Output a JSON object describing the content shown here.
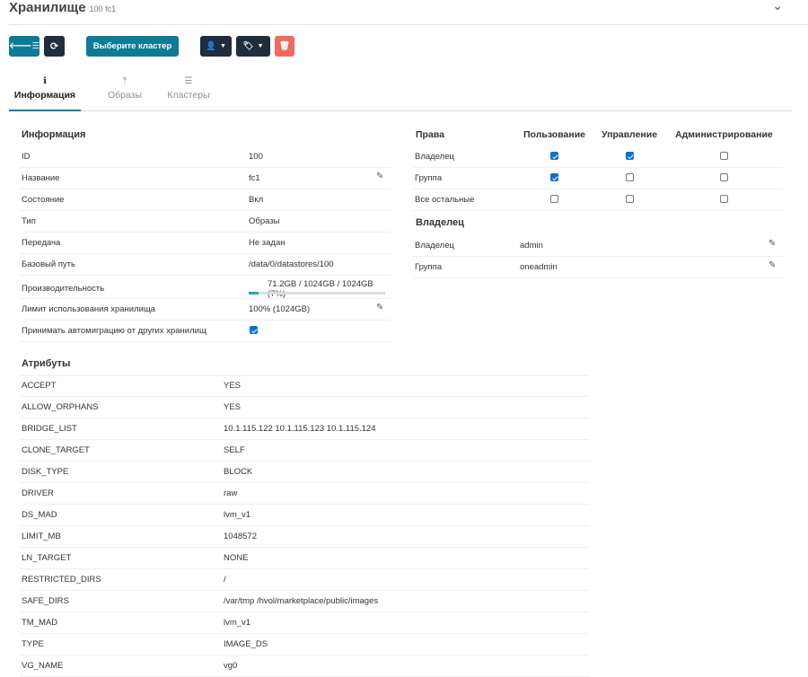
{
  "header": {
    "title": "Хранилище",
    "subtitle": "100 fc1"
  },
  "toolbar": {
    "select_cluster_label": "Выберите кластер",
    "icons": [
      "back-list-icon",
      "refresh-icon",
      "user-icon",
      "tag-icon",
      "trash-icon"
    ]
  },
  "tabs": [
    {
      "label": "Информация",
      "icon": "info-icon",
      "active": true
    },
    {
      "label": "Образы",
      "icon": "upload-icon",
      "active": false
    },
    {
      "label": "Кластеры",
      "icon": "list-icon",
      "active": false
    }
  ],
  "info": {
    "title": "Информация",
    "rows": [
      {
        "key": "ID",
        "value": "100"
      },
      {
        "key": "Название",
        "value": "fc1"
      },
      {
        "key": "Состояние",
        "value": "Вкл"
      },
      {
        "key": "Тип",
        "value": "Образы"
      },
      {
        "key": "Передача",
        "value": "Не задан"
      },
      {
        "key": "Базовый путь",
        "value": "/data/0/datastores/100"
      },
      {
        "key": "Производительность",
        "value": "71.2GB / 1024GB / 1024GB (7%)"
      },
      {
        "key": "Лимит использования хранилища",
        "value": "100% (1024GB)"
      },
      {
        "key": "Принимать автомиграцию от других хранилищ",
        "value": ""
      }
    ],
    "usage_fraction": 0.07,
    "automigration_checked": true
  },
  "permissions": {
    "title": "Права",
    "columns": [
      "Пользование",
      "Управление",
      "Администрирование"
    ],
    "rows": [
      {
        "label": "Владелец",
        "values": [
          true,
          true,
          false
        ]
      },
      {
        "label": "Группа",
        "values": [
          true,
          false,
          false
        ]
      },
      {
        "label": "Все остальные",
        "values": [
          false,
          false,
          false
        ]
      }
    ]
  },
  "ownership": {
    "title": "Владелец",
    "rows": [
      {
        "key": "Владелец",
        "value": "admin"
      },
      {
        "key": "Группа",
        "value": "oneadmin"
      }
    ]
  },
  "attributes": {
    "title": "Атрибуты",
    "rows": [
      {
        "key": "ACCEPT",
        "value": "YES"
      },
      {
        "key": "ALLOW_ORPHANS",
        "value": "YES"
      },
      {
        "key": "BRIDGE_LIST",
        "value": "10.1.115.122 10.1.115.123 10.1.115.124"
      },
      {
        "key": "CLONE_TARGET",
        "value": "SELF"
      },
      {
        "key": "DISK_TYPE",
        "value": "BLOCK"
      },
      {
        "key": "DRIVER",
        "value": "raw"
      },
      {
        "key": "DS_MAD",
        "value": "lvm_v1"
      },
      {
        "key": "LIMIT_MB",
        "value": "1048572"
      },
      {
        "key": "LN_TARGET",
        "value": "NONE"
      },
      {
        "key": "RESTRICTED_DIRS",
        "value": "/"
      },
      {
        "key": "SAFE_DIRS",
        "value": "/var/tmp /hvol/marketplace/public/images"
      },
      {
        "key": "TM_MAD",
        "value": "lvm_v1"
      },
      {
        "key": "TYPE",
        "value": "IMAGE_DS"
      },
      {
        "key": "VG_NAME",
        "value": "vg0"
      }
    ]
  }
}
